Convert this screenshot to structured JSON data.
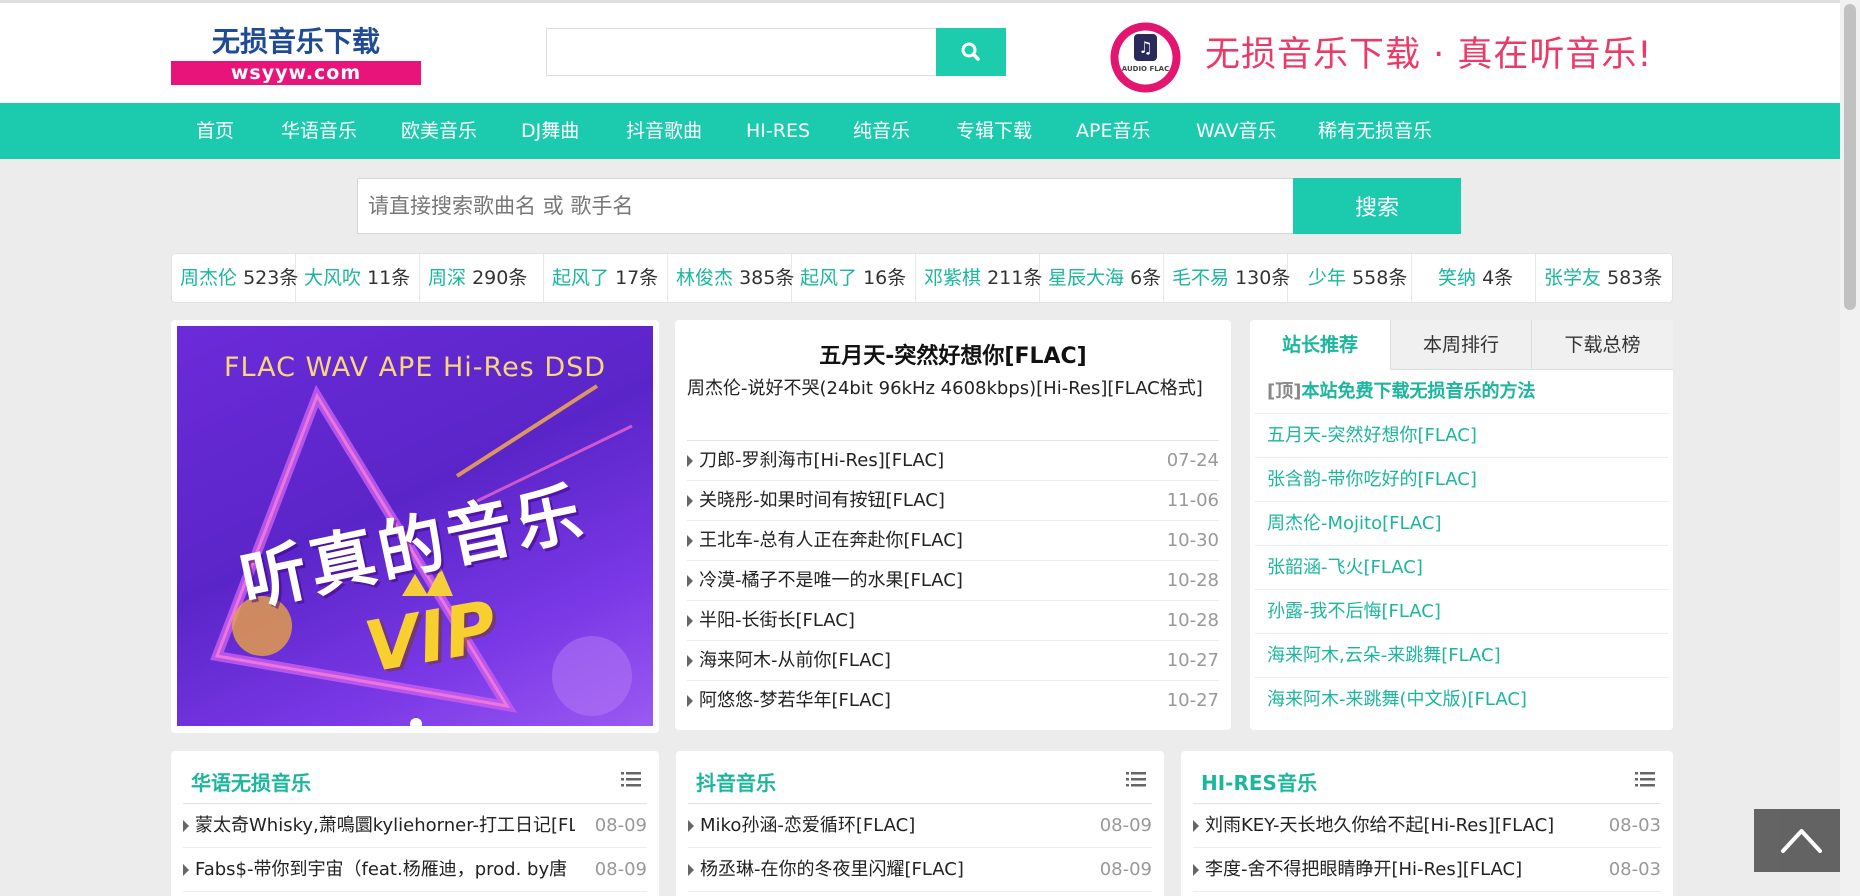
{
  "header": {
    "logo_title": "无损音乐下载",
    "logo_domain": "wsyyw.com",
    "search_placeholder": "",
    "badge_text": "AUDIO FLAC",
    "slogan": "无损音乐下载 · 真在听音乐!"
  },
  "nav": {
    "items": [
      "首页",
      "华语音乐",
      "欧美音乐",
      "DJ舞曲",
      "抖音歌曲",
      "HI-RES",
      "纯音乐",
      "专辑下载",
      "APE音乐",
      "WAV音乐",
      "稀有无损音乐"
    ]
  },
  "search": {
    "placeholder": "请直接搜索歌曲名 或 歌手名",
    "button": "搜索"
  },
  "hot_tags": [
    {
      "name": "周杰伦",
      "count": "523条"
    },
    {
      "name": "大风吹",
      "count": "11条"
    },
    {
      "name": "周深",
      "count": "290条"
    },
    {
      "name": "起风了",
      "count": "17条"
    },
    {
      "name": "林俊杰",
      "count": "385条"
    },
    {
      "name": "起风了",
      "count": "16条"
    },
    {
      "name": "邓紫棋",
      "count": "211条"
    },
    {
      "name": "星辰大海",
      "count": "6条"
    },
    {
      "name": "毛不易",
      "count": "130条"
    },
    {
      "name": "少年",
      "count": "558条"
    },
    {
      "name": "笑纳",
      "count": "4条"
    },
    {
      "name": "张学友",
      "count": "583条"
    }
  ],
  "banner": {
    "top_text": "FLAC WAV APE Hi-Res DSD",
    "main_text": "听真的音乐",
    "vip_text": "VIP"
  },
  "featured": {
    "title": "五月天-突然好想你[FLAC]",
    "subtitle": "周杰伦-说好不哭(24bit 96kHz 4608kbps)[Hi-Res][FLAC格式]",
    "items": [
      {
        "title": "刀郎-罗刹海市[Hi-Res][FLAC]",
        "date": "07-24"
      },
      {
        "title": "关晓彤-如果时间有按钮[FLAC]",
        "date": "11-06"
      },
      {
        "title": "王北车-总有人正在奔赴你[FLAC]",
        "date": "10-30"
      },
      {
        "title": "冷漠-橘子不是唯一的水果[FLAC]",
        "date": "10-28"
      },
      {
        "title": "半阳-长街长[FLAC]",
        "date": "10-28"
      },
      {
        "title": "海来阿木-从前你[FLAC]",
        "date": "10-27"
      },
      {
        "title": "阿悠悠-梦若华年[FLAC]",
        "date": "10-27"
      }
    ]
  },
  "rank": {
    "tabs": [
      "站长推荐",
      "本周排行",
      "下载总榜"
    ],
    "pinned_prefix": "[顶]",
    "items": [
      "本站免费下载无损音乐的方法",
      "五月天-突然好想你[FLAC]",
      "张含韵-带你吃好的[FLAC]",
      "周杰伦-Mojito[FLAC]",
      "张韶涵-飞火[FLAC]",
      "孙露-我不后悔[FLAC]",
      "海来阿木,云朵-来跳舞[FLAC]",
      "海来阿木-来跳舞(中文版)[FLAC]"
    ]
  },
  "columns": [
    {
      "title": "华语无损音乐",
      "items": [
        {
          "title": "蒙太奇Whisky,萧鳴圜kyliehorner-打工日记[FLA",
          "date": "08-09"
        },
        {
          "title": "Fabs$-带你到宇宙（feat.杨雁迪，prod. by唐",
          "date": "08-09"
        }
      ]
    },
    {
      "title": "抖音音乐",
      "items": [
        {
          "title": "Miko孙涵-恋爱循环[FLAC]",
          "date": "08-09"
        },
        {
          "title": "杨丞琳-在你的冬夜里闪耀[FLAC]",
          "date": "08-09"
        }
      ]
    },
    {
      "title": "HI-RES音乐",
      "items": [
        {
          "title": "刘雨KEY-天长地久你给不起[Hi-Res][FLAC]",
          "date": "08-03"
        },
        {
          "title": "李度-舍不得把眼睛睁开[Hi-Res][FLAC]",
          "date": "08-03"
        }
      ]
    }
  ],
  "colors": {
    "accent": "#1ccbad",
    "logo_blue": "#1e4a96",
    "logo_pink": "#e8147a",
    "slogan": "#ec3a66"
  }
}
